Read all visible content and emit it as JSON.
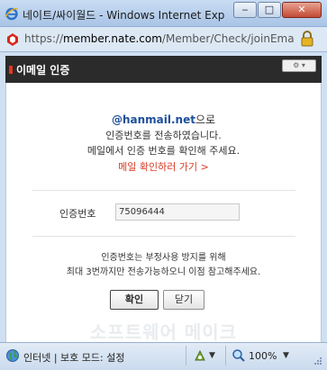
{
  "window": {
    "title": "네이트/싸이월드 - Windows Internet Exp...",
    "minimize": "‒",
    "maximize": "□",
    "close": "✕"
  },
  "address": {
    "scheme": "https://",
    "domain": "member.nate.com",
    "path": "/Member/Check/joinEmailAu"
  },
  "popup": {
    "title": "이메일 인증",
    "email": "@hanmail.net",
    "email_suffix": "으로",
    "message_line1": "인증번호를 전송하였습니다.",
    "message_line2": "메일에서 인증 번호를 확인해 주세요.",
    "link": "메일 확인하러 가기 >",
    "code_label": "인증번호",
    "code_value": "75096444",
    "note_line1": "인증번호는 부정사용 방지를 위해",
    "note_line2": "최대 3번까지만 전송가능하오니 이점 참고해주세요.",
    "confirm_button": "확인",
    "close_button": "닫기",
    "watermark": "소프트웨어 메이크"
  },
  "statusbar": {
    "zone": "인터넷 | 보호 모드: 설정",
    "zoom": "100%",
    "dropdown": "▼"
  },
  "colors": {
    "accent_red": "#d83a24",
    "email_blue": "#1e4f9a",
    "header_dark": "#2b2b2b"
  }
}
